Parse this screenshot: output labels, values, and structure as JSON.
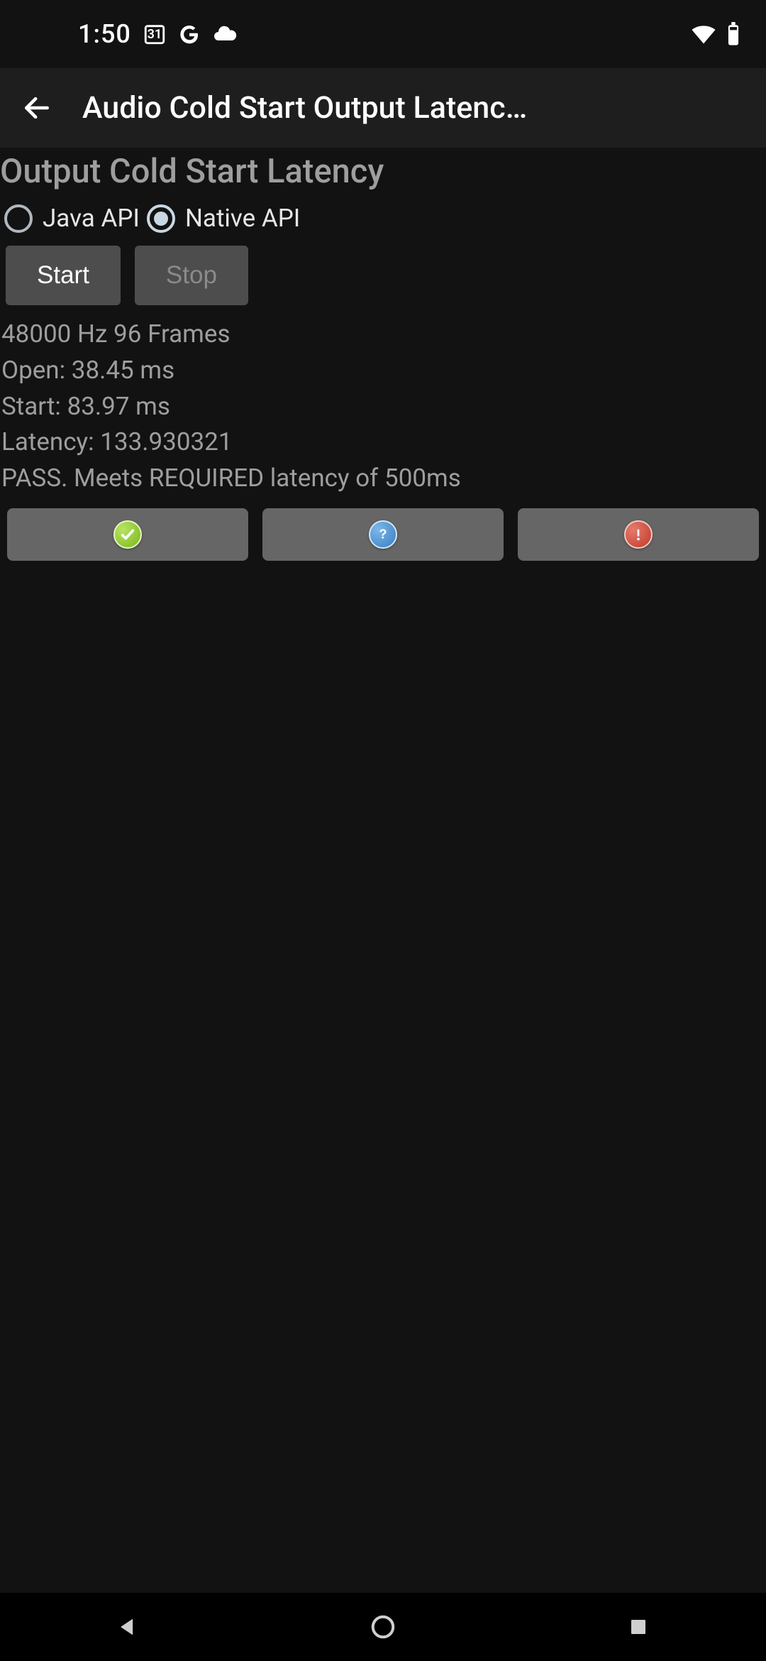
{
  "status": {
    "time": "1:50",
    "calendar_day": "31"
  },
  "appbar": {
    "title": "Audio Cold Start Output Latenc…"
  },
  "section": {
    "heading": "Output Cold Start Latency"
  },
  "radios": {
    "java": {
      "label": "Java API",
      "selected": false
    },
    "native": {
      "label": "Native API",
      "selected": true
    }
  },
  "buttons": {
    "start": "Start",
    "stop": "Stop"
  },
  "results": {
    "text": "48000 Hz 96 Frames\nOpen: 38.45 ms\nStart: 83.97 ms\nLatency: 133.930321\nPASS. Meets REQUIRED latency of 500ms"
  },
  "icons": {
    "pass_name": "check-icon",
    "info_name": "question-icon",
    "fail_name": "exclamation-icon"
  }
}
